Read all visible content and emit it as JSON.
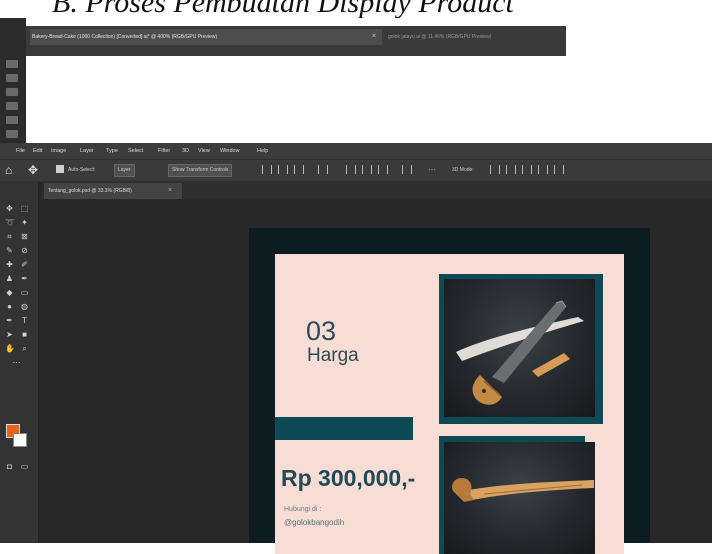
{
  "document": {
    "heading": "B. Proses Pembuatan Display Product"
  },
  "screenshot_top": {
    "active_tab": "Bakery-Bread-Cake (1000 Collection) [Converted].ai* @ 400% (RGB/GPU Preview)",
    "other_tab": "golok jatayu.ai @ 11.46% (RGB/GPU Preview)"
  },
  "screenshot_main": {
    "menu": [
      "File",
      "Edit",
      "Image",
      "Layer",
      "Type",
      "Select",
      "Filter",
      "3D",
      "View",
      "Window",
      "Help"
    ],
    "options": {
      "auto_select_label": "Auto-Select:",
      "auto_select_value": "Layer",
      "transform_label": "Show Transform Controls",
      "mode_label": "3D Mode:"
    },
    "document_tab": "Tentang_golok.psd @ 33.3% (RGB/8)",
    "colors": {
      "foreground": "#e8621d",
      "background": "#ffffff",
      "poster_bg": "#f7ddd5",
      "accent": "#0e4a55",
      "artboard": "#0d1c20"
    }
  },
  "design": {
    "number": "03",
    "title": "Harga",
    "price": "Rp 300,000,-",
    "handle_caption": "Hubungi di :",
    "handle": "@golokbangodih"
  }
}
